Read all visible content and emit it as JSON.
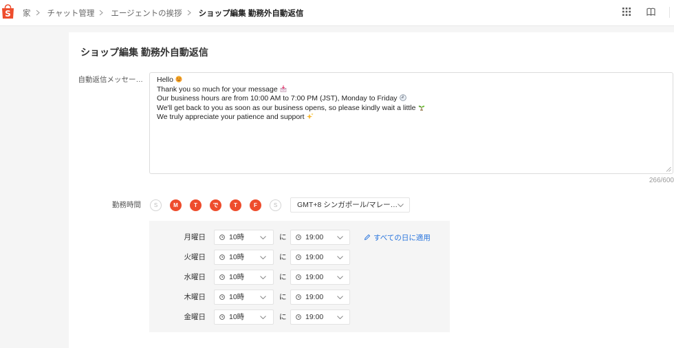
{
  "topbar": {
    "logo_letter": "S",
    "logo_icon": "shopee-bag-icon",
    "breadcrumb": [
      {
        "label": "家"
      },
      {
        "label": "チャット管理"
      },
      {
        "label": "エージェントの挨拶"
      },
      {
        "label": "ショップ編集 勤務外自動返信"
      }
    ],
    "separator_icon": "chevron-right-icon",
    "right_icons": [
      "apps-grid-icon",
      "book-icon"
    ]
  },
  "page": {
    "title": "ショップ編集 勤務外自動返信"
  },
  "auto_reply": {
    "label": "自動返信メッセー…",
    "lines": [
      {
        "text": "Hello",
        "emoji": "smiling-face-emoji"
      },
      {
        "text": "Thank you so much for your message",
        "emoji": "incoming-envelope-emoji"
      },
      {
        "text": "Our business hours are from 10:00 AM to 7:00 PM (JST), Monday to Friday",
        "emoji": "clock-nine-emoji"
      },
      {
        "text": "We'll get back to you as soon as our business opens, so please kindly wait a little",
        "emoji": "seedling-emoji"
      },
      {
        "text": "We truly appreciate your patience and support",
        "emoji": "sparkles-emoji"
      }
    ],
    "char_count": "266/600"
  },
  "work_hours": {
    "label": "勤務時間",
    "days": [
      {
        "letter": "S",
        "selected": false
      },
      {
        "letter": "M",
        "selected": true
      },
      {
        "letter": "T",
        "selected": true
      },
      {
        "letter": "で",
        "selected": true
      },
      {
        "letter": "T",
        "selected": true
      },
      {
        "letter": "F",
        "selected": true
      },
      {
        "letter": "S",
        "selected": false
      }
    ],
    "timezone": "GMT+8 シンガポール/マレー…",
    "to_label": "に",
    "apply_all_label": "すべての日に適用",
    "schedule": [
      {
        "day": "月曜日",
        "start": "10時",
        "end": "19:00"
      },
      {
        "day": "火曜日",
        "start": "10時",
        "end": "19:00"
      },
      {
        "day": "水曜日",
        "start": "10時",
        "end": "19:00"
      },
      {
        "day": "木曜日",
        "start": "10時",
        "end": "19:00"
      },
      {
        "day": "金曜日",
        "start": "10時",
        "end": "19:00"
      }
    ]
  },
  "colors": {
    "accent": "#ee4d2d",
    "link": "#2673dd",
    "panel_background": "#f5f5f5"
  }
}
